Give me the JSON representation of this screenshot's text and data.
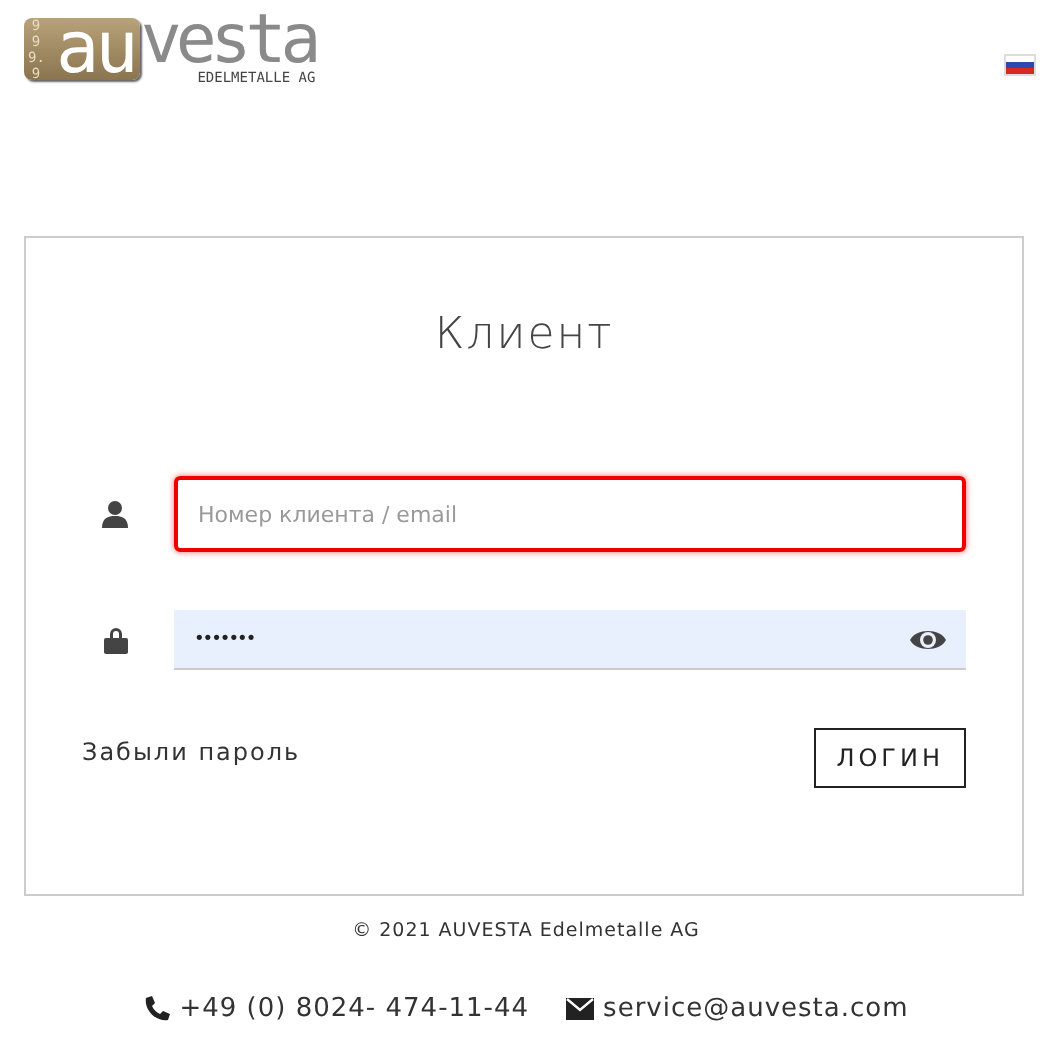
{
  "logo": {
    "badge": "999.9",
    "au": "au",
    "vesta": "vesta",
    "subtitle": "EDELMETALLE AG"
  },
  "language": {
    "kind": "russia"
  },
  "login": {
    "title": "Клиент",
    "fields": [
      {
        "kind": "user",
        "placeholder": "Номер клиента / email",
        "invalid": true
      },
      {
        "kind": "password",
        "value": "•••••••",
        "invalid": false
      }
    ],
    "forgot_link": "Забыли пароль",
    "submit_button": "ЛОГИН"
  },
  "footer": {
    "copyright": "© 2021 AUVESTA Edelmetalle AG",
    "phone": "+49 (0) 8024- 474-11-44",
    "email": "service@auvesta.com"
  }
}
